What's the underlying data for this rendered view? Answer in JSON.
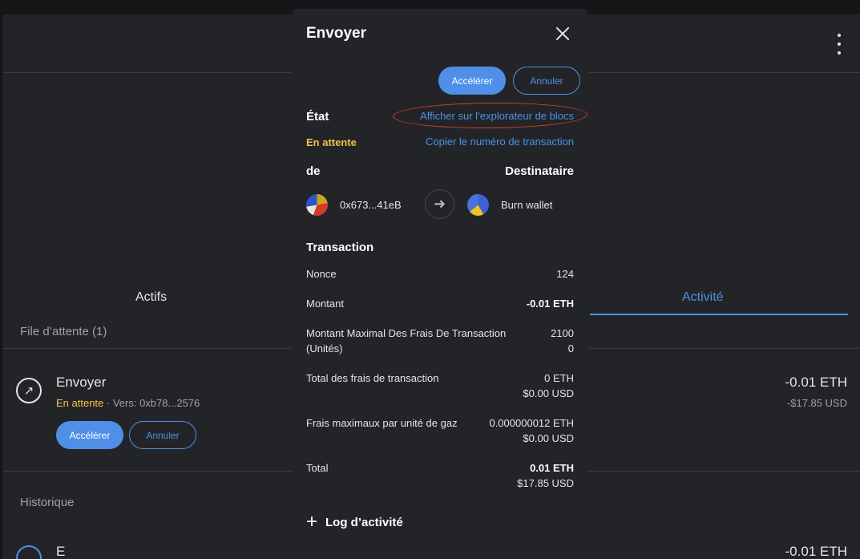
{
  "background": {
    "tabs": {
      "assets": "Actifs",
      "activity": "Activité"
    },
    "queue_title": "File d’attente (1)",
    "pending_tx": {
      "title": "Envoyer",
      "status": "En attente",
      "separator": " · Vers: ",
      "to": "0xb78...2576",
      "amount": "-0.01 ETH",
      "fiat": "-$17.85 USD",
      "speed_up": "Accélérer",
      "cancel": "Annuler"
    },
    "history_title": "Historique",
    "history_tx": {
      "title": "E",
      "amount": "-0.01 ETH"
    }
  },
  "modal": {
    "title": "Envoyer",
    "speed_up": "Accélérer",
    "cancel": "Annuler",
    "status_label": "État",
    "view_explorer": "Afficher sur l’explorateur de blocs",
    "status_value": "En attente",
    "copy_tx_id": "Copier le numéro de transaction",
    "from_label": "de",
    "to_label": "Destinataire",
    "from_address": "0x673...41eB",
    "to_name": "Burn wallet",
    "transaction_heading": "Transaction",
    "rows": [
      {
        "label": "Nonce",
        "value": "124"
      },
      {
        "label": "Montant",
        "value": "-0.01 ETH"
      },
      {
        "label_line1": "Montant Maximal Des Frais De Transaction",
        "label_line2": "(Unités)",
        "value_line1": "2100",
        "value_line2": "0"
      },
      {
        "label": "Total des frais de transaction",
        "value_line1": "0 ETH",
        "value_line2": "$0.00 USD"
      },
      {
        "label": "Frais maximaux par unité de gaz",
        "value_line1": "0.000000012 ETH",
        "value_line2": "$0.00 USD"
      },
      {
        "label": "Total",
        "value_line1": "0.01 ETH",
        "value_line2": "$17.85 USD"
      }
    ],
    "activity_log": "Log d’activité"
  },
  "colors": {
    "accent": "#4f8fe8",
    "pending": "#f3c14a",
    "annotation": "#d23c32",
    "panel": "#232427"
  }
}
